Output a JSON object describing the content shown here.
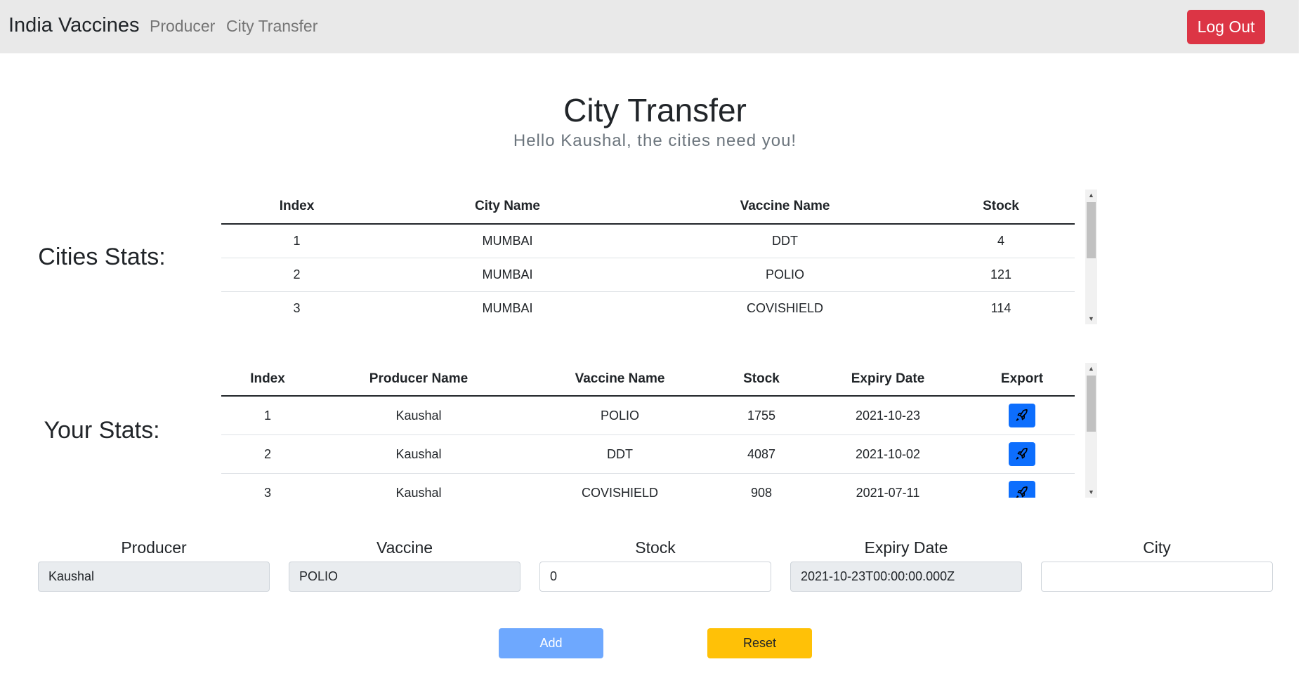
{
  "navbar": {
    "brand": "India Vaccines",
    "links": [
      "Producer",
      "City Transfer"
    ],
    "logout_label": "Log Out"
  },
  "header": {
    "title": "City Transfer",
    "subtitle": "Hello Kaushal, the cities need you!"
  },
  "cities_stats": {
    "label": "Cities Stats:",
    "columns": [
      "Index",
      "City Name",
      "Vaccine Name",
      "Stock"
    ],
    "rows": [
      [
        "1",
        "MUMBAI",
        "DDT",
        "4"
      ],
      [
        "2",
        "MUMBAI",
        "POLIO",
        "121"
      ],
      [
        "3",
        "MUMBAI",
        "COVISHIELD",
        "114"
      ]
    ]
  },
  "your_stats": {
    "label": "Your Stats:",
    "columns": [
      "Index",
      "Producer Name",
      "Vaccine Name",
      "Stock",
      "Expiry Date",
      "Export"
    ],
    "rows": [
      [
        "1",
        "Kaushal",
        "POLIO",
        "1755",
        "2021-10-23"
      ],
      [
        "2",
        "Kaushal",
        "DDT",
        "4087",
        "2021-10-02"
      ],
      [
        "3",
        "Kaushal",
        "COVISHIELD",
        "908",
        "2021-07-11"
      ]
    ],
    "export_icon": "rocket-icon"
  },
  "form": {
    "producer": {
      "label": "Producer",
      "value": "Kaushal"
    },
    "vaccine": {
      "label": "Vaccine",
      "value": "POLIO"
    },
    "stock": {
      "label": "Stock",
      "value": "0"
    },
    "expiry": {
      "label": "Expiry Date",
      "value": "2021-10-23T00:00:00.000Z"
    },
    "city": {
      "label": "City",
      "value": ""
    }
  },
  "buttons": {
    "add_label": "Add",
    "reset_label": "Reset"
  },
  "colors": {
    "navbar_bg": "#e9e9e9",
    "logout": "#dc3545",
    "export": "#0d6efd",
    "add": "#6ea8fe",
    "reset": "#ffc107"
  }
}
